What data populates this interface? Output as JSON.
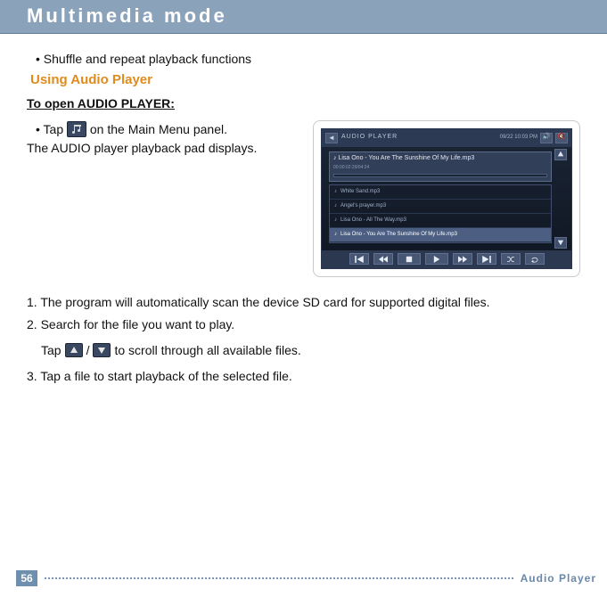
{
  "header": {
    "title": "Multimedia mode"
  },
  "content": {
    "feature_bullet": "• Shuffle and repeat playback functions",
    "subsection": "Using Audio Player",
    "open_heading": "To open AUDIO PLAYER:",
    "tap_prefix": "• Tap ",
    "tap_suffix": " on the Main Menu panel.",
    "playback_displays": "The AUDIO player playback pad displays.",
    "step1": "1. The program will automatically scan the device SD card for supported digital files.",
    "step2": "2. Search for the file you want to play.",
    "step2_sub_prefix": "Tap ",
    "step2_sub_mid": "/",
    "step2_sub_suffix": " to scroll through all available files.",
    "step3": "3. Tap a file to start playback of the selected file."
  },
  "player": {
    "app_label": "AUDIO PLAYER",
    "time": "09/22   10:03 PM",
    "now_playing_title": "♪ Lisa Ono - You Are The Sunshine Of My Life.mp3",
    "progress_text": "00:00:02:29/04:24",
    "list": [
      "White Sand.mp3",
      "Angel's prayer.mp3",
      "Lisa Ono - All The Way.mp3",
      "Lisa Ono - You Are The Sunshine Of My Life.mp3"
    ],
    "selected_index": 3
  },
  "footer": {
    "page": "56",
    "label": "Audio Player"
  }
}
